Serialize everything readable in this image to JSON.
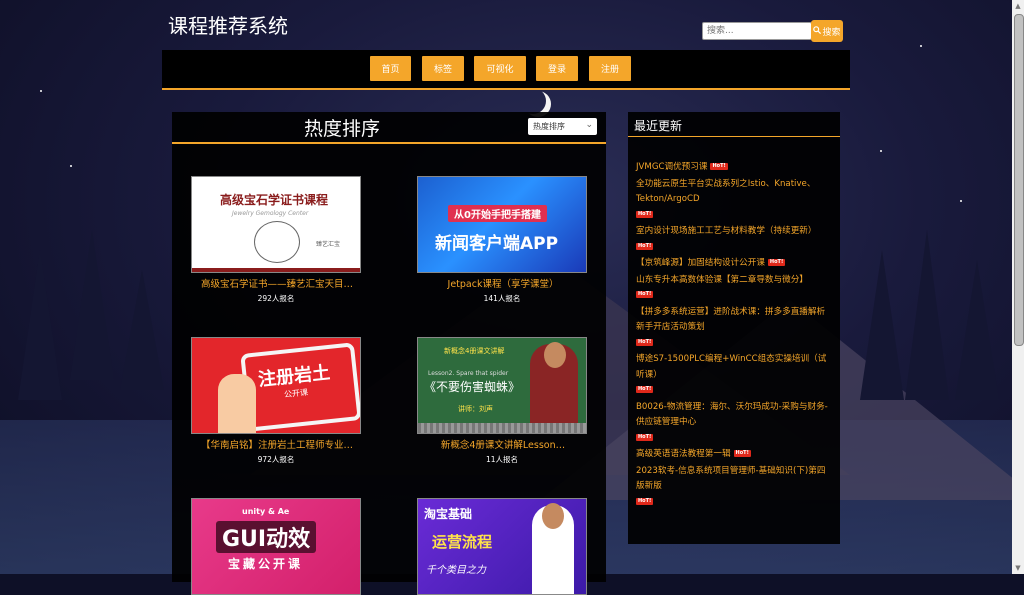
{
  "site": {
    "title": "课程推荐系统"
  },
  "search": {
    "placeholder": "搜索...",
    "button_label": "搜索"
  },
  "nav": {
    "items": [
      "首页",
      "标签",
      "可视化",
      "登录",
      "注册"
    ]
  },
  "main": {
    "title": "热度排序",
    "sort_select": {
      "value": "热度排序"
    },
    "courses": [
      {
        "title": "高级宝石学证书——臻艺汇宝天目…",
        "count": "292人报名",
        "thumb": {
          "text": "高级宝石学证书课程",
          "sub": "Jewelry  Gemology  Center",
          "logo": "臻艺汇宝"
        }
      },
      {
        "title": "Jetpack课程（享学课堂）",
        "count": "141人报名",
        "thumb": {
          "pill": "从0开始手把手搭建",
          "big": "新闻客户端APP"
        }
      },
      {
        "title": "【华南启铭】注册岩土工程师专业…",
        "count": "972人报名",
        "thumb": {
          "big": "注册岩土",
          "small": "公开课"
        }
      },
      {
        "title": "新概念4册课文讲解Lesson…",
        "count": "11人报名",
        "thumb": {
          "top": "新概念4册课文讲解",
          "mid": "Lesson2. Spare that spider",
          "big": "《不要伤害蜘蛛》",
          "lecturer": "讲师：刘声"
        }
      },
      {
        "title": "",
        "count": "",
        "thumb": {
          "top": "unity  &  Ae",
          "big": "GUI动效",
          "bottom": "宝藏公开课"
        }
      },
      {
        "title": "",
        "count": "",
        "thumb": {
          "top": "淘宝基础",
          "big": "运营流程",
          "bottom": "千个类目之力"
        }
      }
    ]
  },
  "sidebar": {
    "title": "最近更新",
    "hot_label": "HoT!",
    "items": [
      "JVMGC调优预习课",
      "全功能云原生平台实战系列之Istio、Knative、Tekton/ArgoCD",
      "室内设计现场施工工艺与材料教学（持续更新）",
      "【京筑峰源】加固结构设计公开课",
      "山东专升本高数体验课【第二章导数与微分】",
      "【拼多多系统运营】进阶战术课：拼多多直播解析新手开店活动策划",
      "博途S7-1500PLC编程+WinCC组态实操培训（试听课）",
      "B0026-物流管理：海尔、沃尔玛成功-采购与财务-供应链管理中心",
      "高级英语语法教程第一辑",
      "2023软考-信息系统项目管理师-基础知识(下)第四版新版"
    ]
  },
  "colors": {
    "accent": "#f4a62a",
    "hot": "#e0281a",
    "panel": "#000000"
  },
  "icons": {
    "search": "search-icon"
  }
}
